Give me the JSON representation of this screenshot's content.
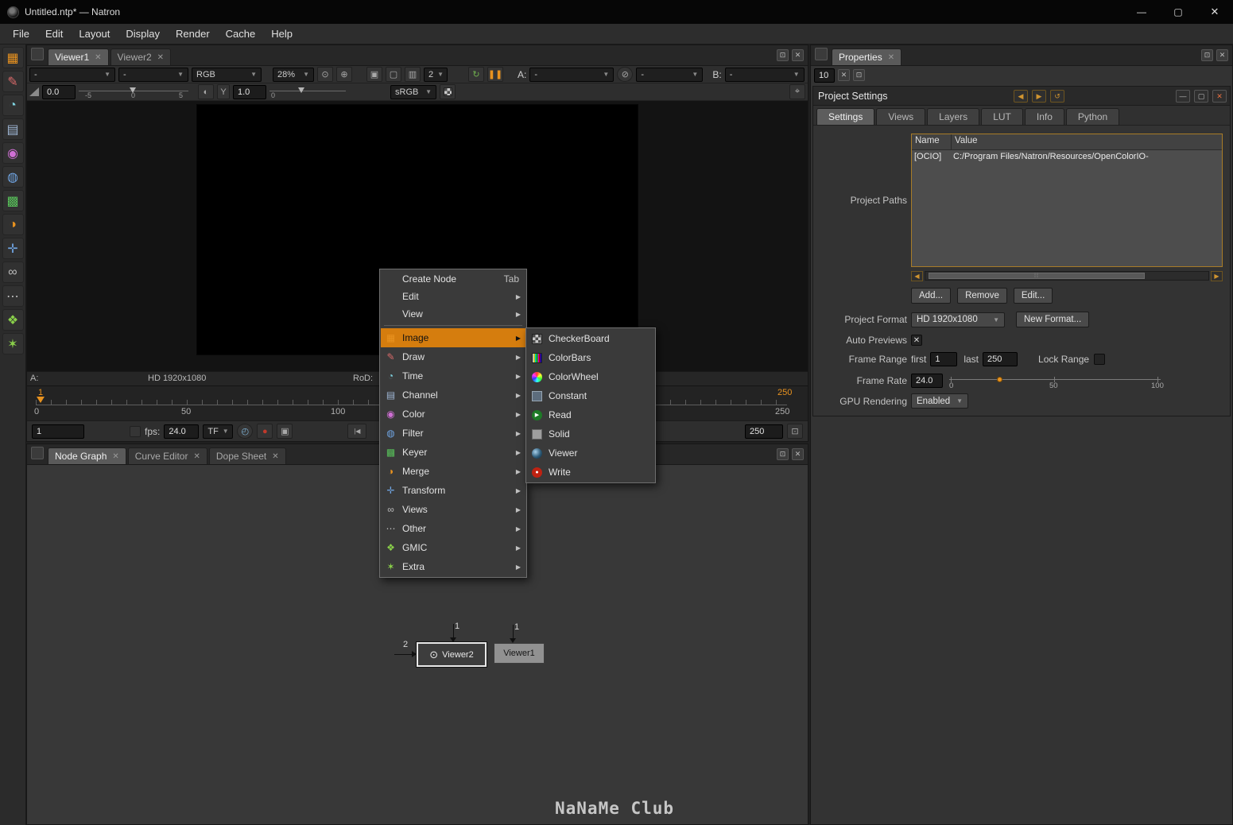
{
  "window": {
    "title": "Untitled.ntp* — Natron",
    "menus": [
      "File",
      "Edit",
      "Layout",
      "Display",
      "Render",
      "Cache",
      "Help"
    ]
  },
  "left_toolbar_icons": [
    "image",
    "draw",
    "time",
    "channel",
    "color",
    "filter",
    "keyer",
    "merge",
    "transform",
    "views",
    "other",
    "gmic",
    "extra"
  ],
  "viewer": {
    "tabs": [
      "Viewer1",
      "Viewer2"
    ],
    "toolbar": {
      "layer": "-",
      "alpha": "-",
      "display_channels": "RGB",
      "zoom": "28%",
      "proxy_level": "2",
      "input_a_label": "A:",
      "input_a": "-",
      "operator": "-",
      "input_b_label": "B:",
      "input_b": "-"
    },
    "gain": {
      "value": "0.0",
      "ticks": [
        "-5",
        "0",
        "5"
      ]
    },
    "gamma": {
      "label": "Y",
      "value": "1.0",
      "tick0": "0"
    },
    "colorspace": "sRGB",
    "infobar": {
      "a": "A:",
      "format": "HD 1920x1080",
      "rod": "RoD:"
    },
    "timeline": {
      "current_frame": "1",
      "out_top": "250",
      "ticks": [
        "0",
        "50",
        "100"
      ],
      "end": "250"
    },
    "playback": {
      "in_point": "1",
      "fps_label": "fps:",
      "fps": "24.0",
      "timeformat": "TF",
      "first_frame": "|◀",
      "out_point": "250"
    }
  },
  "context_menu": {
    "items": [
      {
        "label": "Create Node",
        "shortcut": "Tab"
      },
      {
        "label": "Edit"
      },
      {
        "label": "View"
      },
      {
        "label": "Image",
        "icon": "image"
      },
      {
        "label": "Draw",
        "icon": "draw"
      },
      {
        "label": "Time",
        "icon": "time"
      },
      {
        "label": "Channel",
        "icon": "channel"
      },
      {
        "label": "Color",
        "icon": "color"
      },
      {
        "label": "Filter",
        "icon": "filter"
      },
      {
        "label": "Keyer",
        "icon": "keyer"
      },
      {
        "label": "Merge",
        "icon": "merge"
      },
      {
        "label": "Transform",
        "icon": "transform"
      },
      {
        "label": "Views",
        "icon": "views"
      },
      {
        "label": "Other",
        "icon": "other"
      },
      {
        "label": "GMIC",
        "icon": "gmic"
      },
      {
        "label": "Extra",
        "icon": "extra"
      }
    ]
  },
  "image_submenu": {
    "items": [
      {
        "label": "CheckerBoard",
        "icon": "checkerboard"
      },
      {
        "label": "ColorBars",
        "icon": "colorbars"
      },
      {
        "label": "ColorWheel",
        "icon": "colorwheel"
      },
      {
        "label": "Constant",
        "icon": "constant"
      },
      {
        "label": "Read",
        "icon": "read"
      },
      {
        "label": "Solid",
        "icon": "solid"
      },
      {
        "label": "Viewer",
        "icon": "viewer"
      },
      {
        "label": "Write",
        "icon": "write"
      }
    ]
  },
  "bottom_pane": {
    "tabs": [
      "Node Graph",
      "Curve Editor",
      "Dope Sheet"
    ],
    "nodes": [
      {
        "label": "Viewer2",
        "inputs": [
          "1",
          "2"
        ]
      },
      {
        "label": "Viewer1",
        "inputs": [
          "1"
        ]
      }
    ],
    "watermark": "NaNaMe Club"
  },
  "properties": {
    "tab": "Properties",
    "max_panels": "10",
    "project_settings": {
      "title": "Project Settings",
      "tabs": [
        "Settings",
        "Views",
        "Layers",
        "LUT",
        "Info",
        "Python"
      ],
      "paths_label": "Project Paths",
      "table": {
        "headers": [
          "Name",
          "Value"
        ],
        "rows": [
          {
            "name": "[OCIO]",
            "value": "C:/Program Files/Natron/Resources/OpenColorIO-"
          }
        ]
      },
      "buttons": {
        "add": "Add...",
        "remove": "Remove",
        "edit": "Edit..."
      },
      "format": {
        "label": "Project Format",
        "value": "HD 1920x1080",
        "new_button": "New Format..."
      },
      "auto_previews_label": "Auto Previews",
      "frame_range": {
        "label": "Frame Range",
        "first_label": "first",
        "first": "1",
        "last_label": "last",
        "last": "250",
        "lock_label": "Lock Range"
      },
      "frame_rate": {
        "label": "Frame Rate",
        "value": "24.0",
        "ticks": [
          "0",
          "50",
          "100"
        ]
      },
      "gpu": {
        "label": "GPU Rendering",
        "value": "Enabled"
      }
    }
  }
}
